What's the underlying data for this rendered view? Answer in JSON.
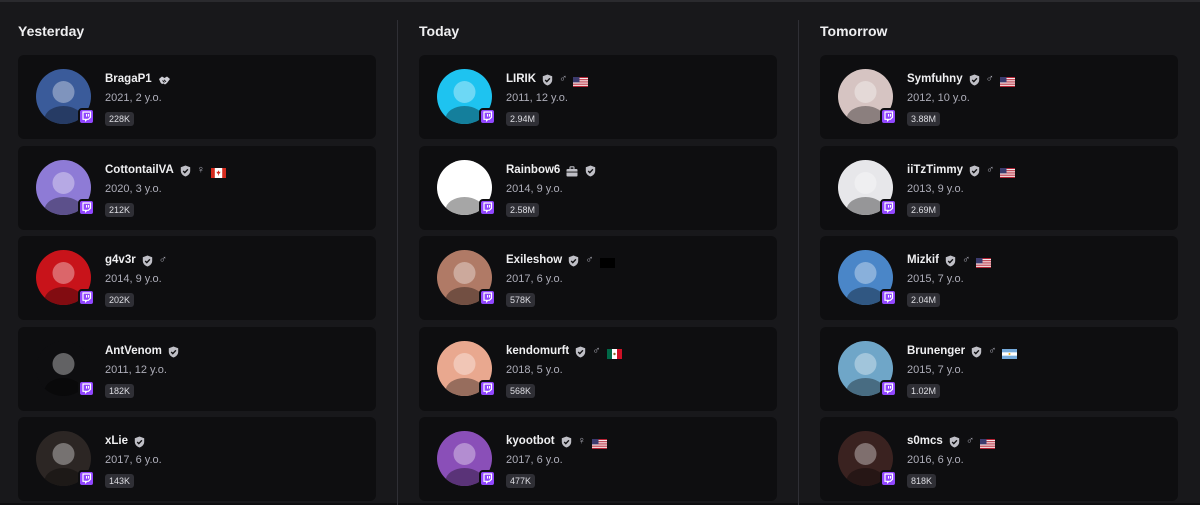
{
  "columns": [
    {
      "title": "Yesterday",
      "cards": [
        {
          "name": "BragaP1",
          "meta": "2021, 2 y.o.",
          "followers": "228K",
          "verified": false,
          "gender": "",
          "flag": "",
          "icon": "handshake-icon",
          "avatar_color": "#3a5b9a"
        },
        {
          "name": "CottontailVA",
          "meta": "2020, 3 y.o.",
          "followers": "212K",
          "verified": true,
          "gender": "♀",
          "flag": "canada",
          "icon": "",
          "avatar_color": "#8e7bd6"
        },
        {
          "name": "g4v3r",
          "meta": "2014, 9 y.o.",
          "followers": "202K",
          "verified": true,
          "gender": "♂",
          "flag": "",
          "icon": "",
          "avatar_color": "#c8131a"
        },
        {
          "name": "AntVenom",
          "meta": "2011, 12 y.o.",
          "followers": "182K",
          "verified": true,
          "gender": "",
          "flag": "",
          "icon": "",
          "avatar_color": "#0e0e10"
        },
        {
          "name": "xLie",
          "meta": "2017, 6 y.o.",
          "followers": "143K",
          "verified": true,
          "gender": "",
          "flag": "",
          "icon": "",
          "avatar_color": "#2c2624"
        }
      ]
    },
    {
      "title": "Today",
      "cards": [
        {
          "name": "LIRIK",
          "meta": "2011, 12 y.o.",
          "followers": "2.94M",
          "verified": true,
          "gender": "♂",
          "flag": "usa",
          "icon": "",
          "avatar_color": "#1ec3f0"
        },
        {
          "name": "Rainbow6",
          "meta": "2014, 9 y.o.",
          "followers": "2.58M",
          "verified": true,
          "gender": "",
          "flag": "",
          "icon": "briefcase-icon",
          "avatar_color": "#ffffff"
        },
        {
          "name": "Exileshow",
          "meta": "2017, 6 y.o.",
          "followers": "578K",
          "verified": true,
          "gender": "♂",
          "flag": "black",
          "icon": "",
          "avatar_color": "#b07a66"
        },
        {
          "name": "kendomurft",
          "meta": "2018, 5 y.o.",
          "followers": "568K",
          "verified": true,
          "gender": "♂",
          "flag": "mexico",
          "icon": "",
          "avatar_color": "#e9a88f"
        },
        {
          "name": "kyootbot",
          "meta": "2017, 6 y.o.",
          "followers": "477K",
          "verified": true,
          "gender": "♀",
          "flag": "usa",
          "icon": "",
          "avatar_color": "#8a4fb8"
        }
      ]
    },
    {
      "title": "Tomorrow",
      "cards": [
        {
          "name": "Symfuhny",
          "meta": "2012, 10 y.o.",
          "followers": "3.88M",
          "verified": true,
          "gender": "♂",
          "flag": "usa",
          "icon": "",
          "avatar_color": "#d6c4c2"
        },
        {
          "name": "iiTzTimmy",
          "meta": "2013, 9 y.o.",
          "followers": "2.69M",
          "verified": true,
          "gender": "♂",
          "flag": "usa",
          "icon": "",
          "avatar_color": "#e7e7ea"
        },
        {
          "name": "Mizkif",
          "meta": "2015, 7 y.o.",
          "followers": "2.04M",
          "verified": true,
          "gender": "♂",
          "flag": "usa",
          "icon": "",
          "avatar_color": "#4a86c8"
        },
        {
          "name": "Brunenger",
          "meta": "2015, 7 y.o.",
          "followers": "1.02M",
          "verified": true,
          "gender": "♂",
          "flag": "argentina",
          "icon": "",
          "avatar_color": "#6fa6c8"
        },
        {
          "name": "s0mcs",
          "meta": "2016, 6 y.o.",
          "followers": "818K",
          "verified": true,
          "gender": "♂",
          "flag": "usa",
          "icon": "",
          "avatar_color": "#3a2220"
        }
      ]
    }
  ],
  "colors": {
    "background": "#18181b",
    "card": "#0e0e10",
    "twitch_purple": "#9147ff",
    "badge_bg": "#2f2f35"
  }
}
